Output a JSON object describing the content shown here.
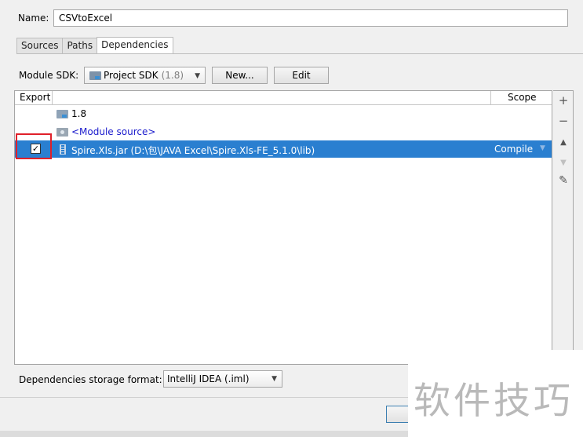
{
  "name_row": {
    "label": "Name:",
    "value": "CSVtoExcel"
  },
  "tabs": [
    {
      "label": "Sources",
      "active": false
    },
    {
      "label": "Paths",
      "active": false
    },
    {
      "label": "Dependencies",
      "active": true
    }
  ],
  "module_sdk": {
    "label": "Module SDK:",
    "selected": "Project SDK",
    "version": "(1.8)",
    "new_button": "New...",
    "edit_button": "Edit"
  },
  "table": {
    "columns": {
      "export": "Export",
      "scope": "Scope"
    },
    "rows": [
      {
        "label": "1.8",
        "icon": "sdk-folder-icon"
      },
      {
        "label": "<Module source>",
        "icon": "module-folder-icon"
      },
      {
        "label": "Spire.Xls.jar (D:\\包\\JAVA Excel\\Spire.Xls-FE_5.1.0\\lib)",
        "icon": "jar-icon",
        "scope": "Compile",
        "export_checked": true,
        "selected": true
      }
    ],
    "checkbox_mark": "✓",
    "scope_dropdown_glyph": "▼"
  },
  "toolbar": {
    "add": "+",
    "remove": "−",
    "move_up": "▲",
    "move_down": "▼",
    "edit": "✎"
  },
  "storage": {
    "label": "Dependencies storage format:",
    "selected": "IntelliJ IDEA (.iml)"
  },
  "watermark": "软件技巧",
  "colors": {
    "selection": "#2a7fd0",
    "highlight_box": "#e0202a",
    "module_source_text": "#1a1acc"
  }
}
